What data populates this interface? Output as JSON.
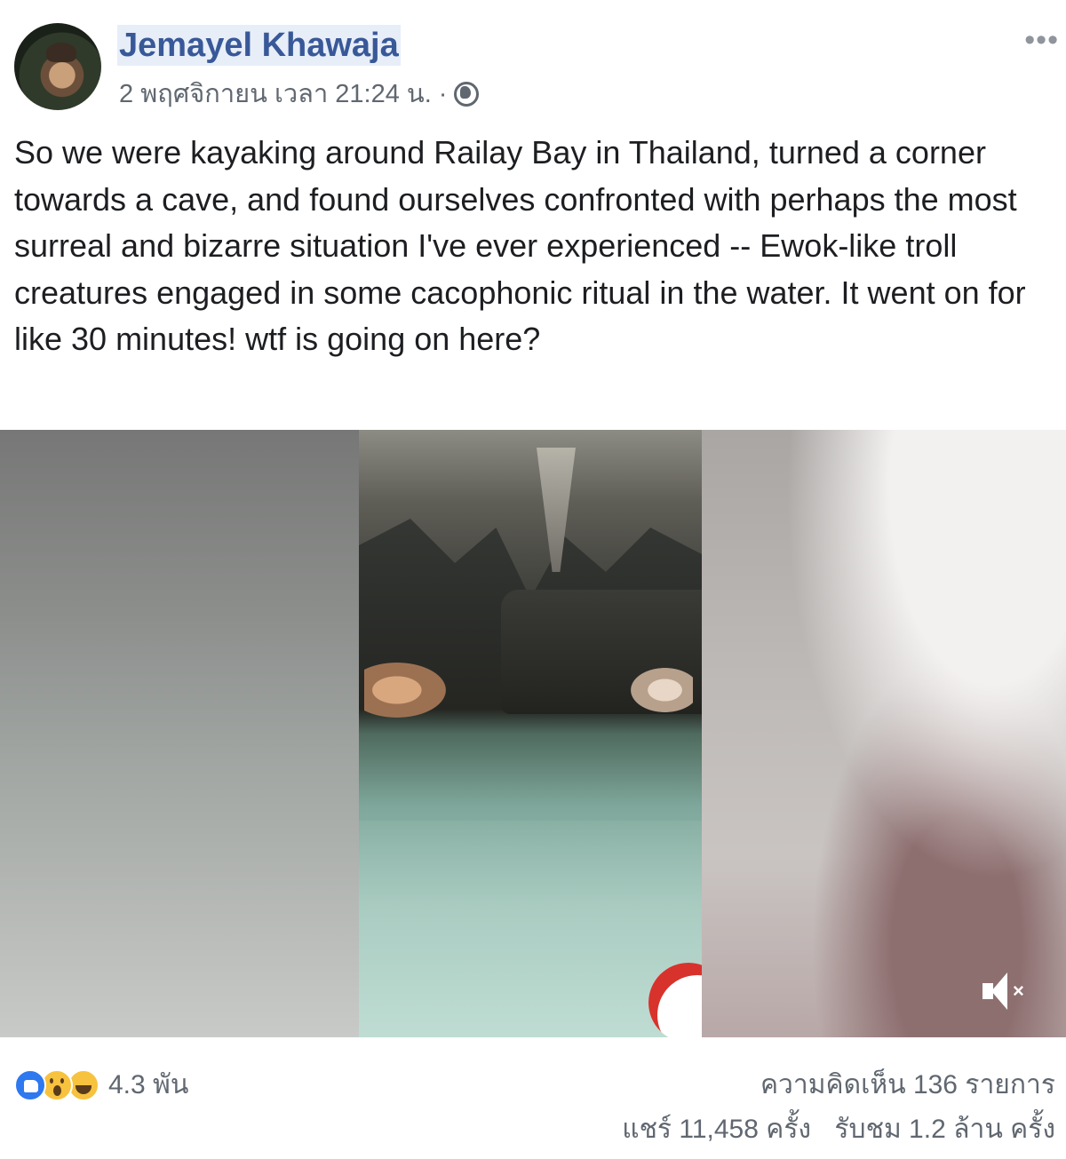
{
  "post": {
    "author": "Jemayel Khawaja",
    "timestamp": "2 พฤศจิกายน เวลา 21:24 น.",
    "separator": "·",
    "audience_icon": "globe-icon",
    "more_label": "•••",
    "text": "So we were kayaking around Railay Bay in Thailand, turned a corner towards a cave, and found ourselves confronted with perhaps the most surreal and bizarre situation I've ever experienced -- Ewok-like troll creatures engaged in some cacophonic ritual in the water. It went on for like 30 minutes! wtf is going on here?"
  },
  "video": {
    "sound_icon": "muted-speaker-icon",
    "sound_x": "×"
  },
  "footer": {
    "reaction_icons": [
      "like-icon",
      "wow-icon",
      "haha-icon"
    ],
    "reaction_count": "4.3 พัน",
    "comments": "ความคิดเห็น 136 รายการ",
    "shares": "แชร์ 11,458 ครั้ง",
    "views": "รับชม 1.2 ล้าน ครั้ง"
  },
  "colors": {
    "author_link": "#385898",
    "secondary_text": "#606770",
    "like_blue": "#2e78f0",
    "emoji_yellow": "#f7c23d"
  }
}
